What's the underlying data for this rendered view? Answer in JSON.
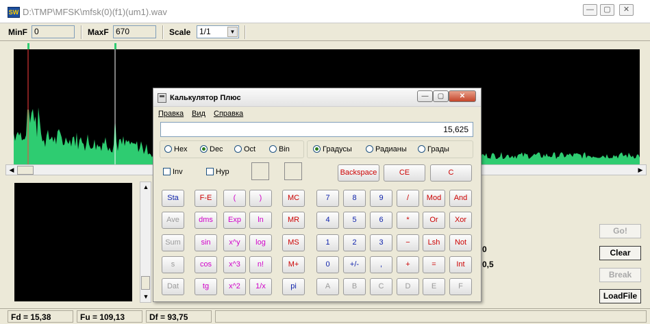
{
  "app": {
    "title": "D:\\TMP\\MFSK\\mfsk(0)(f1)(um1).wav",
    "logo_text": "SW",
    "win_minimize": "—",
    "win_maximize": "▢",
    "win_close": "✕"
  },
  "toolbar": {
    "minf_label": "MinF",
    "minf_value": "0",
    "maxf_label": "MaxF",
    "maxf_value": "670",
    "scale_label": "Scale",
    "scale_value": "1/1"
  },
  "side": {
    "value1": "0",
    "value2": "0,5",
    "go_label": "Go!",
    "clear_label": "Clear",
    "break_label": "Break",
    "loadfile_label": "LoadFile"
  },
  "status": {
    "fd": "Fd = 15,38",
    "fu": "Fu = 109,13",
    "df": "Df = 93,75"
  },
  "colors": {
    "spectrum": "#2ecc71",
    "marker_red": "#ff4040",
    "marker_white": "#ffffff"
  },
  "calculator": {
    "title": "Калькулятор Плюс",
    "menu": [
      "Правка",
      "Вид",
      "Справка"
    ],
    "display": "15,625",
    "bases": [
      "Hex",
      "Dec",
      "Oct",
      "Bin"
    ],
    "base_selected": "Dec",
    "angles": [
      "Градусы",
      "Радианы",
      "Грады"
    ],
    "angle_selected": "Градусы",
    "inv_label": "Inv",
    "hyp_label": "Hyp",
    "backspace": "Backspace",
    "ce": "CE",
    "c": "C",
    "buttons": [
      [
        "Sta",
        "F-E",
        "(",
        ")",
        "MC",
        "7",
        "8",
        "9",
        "/",
        "Mod",
        "And"
      ],
      [
        "Ave",
        "dms",
        "Exp",
        "ln",
        "MR",
        "4",
        "5",
        "6",
        "*",
        "Or",
        "Xor"
      ],
      [
        "Sum",
        "sin",
        "x^y",
        "log",
        "MS",
        "1",
        "2",
        "3",
        "−",
        "Lsh",
        "Not"
      ],
      [
        "s",
        "cos",
        "x^3",
        "n!",
        "M+",
        "0",
        "+/-",
        ",",
        "+",
        "=",
        "Int"
      ],
      [
        "Dat",
        "tg",
        "x^2",
        "1/x",
        "pi",
        "A",
        "B",
        "C",
        "D",
        "E",
        "F"
      ]
    ]
  }
}
